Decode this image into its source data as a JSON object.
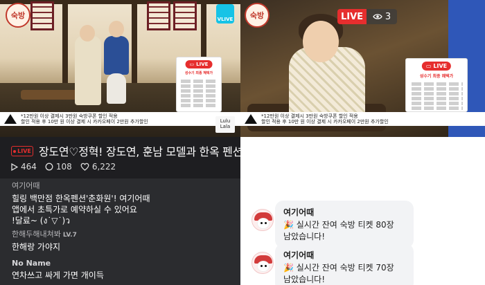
{
  "left": {
    "video": {
      "logo_text": "숙방",
      "vlive_label": "VLIVE",
      "promo": {
        "live_label": "LIVE",
        "title": "성수기 최종 혜택가"
      },
      "banner_lines": [
        "*12만원 이상 결제시 3만원 숙방쿠폰 할인 적용",
        "할인 적용 후 10만 원 이상 결제 시 카카오페이 2만원 추가할인"
      ],
      "watermark_lines": [
        "Lulu",
        "Lala"
      ]
    },
    "stream": {
      "live_label": "LIVE",
      "title": "장도연♡정혁! 장도연, 훈남 모델과 한옥 펜션",
      "stats": {
        "plays": "464",
        "comments": "108",
        "likes": "6,222"
      }
    },
    "chat": [
      {
        "author": "여기어때",
        "level": "",
        "bold": false,
        "lines": [
          "힐링 백만점 한옥펜션'춘화원'! 여기어때",
          "앱에서 초특가로 예약하실 수 있어요",
          "!달료~ (ง˙▽˙)ว"
        ]
      },
      {
        "author": "한해두해내쳐봐",
        "level": "LV.7",
        "bold": false,
        "lines": [
          "한해랑 가야지"
        ]
      },
      {
        "author": "No Name",
        "level": "",
        "bold": true,
        "lines": [
          "연차쓰고 싸게 가면 개이득"
        ]
      }
    ]
  },
  "right": {
    "video": {
      "logo_text": "숙방",
      "live_label": "LIVE",
      "viewer_count": "3",
      "promo": {
        "live_label": "LIVE",
        "title": "성수기 최종 혜택가"
      },
      "banner_lines": [
        "*12만원 이상 결제시 3만원 숙방쿠폰 할인 적용",
        "할인 적용 후 10만 원 이상 결제 시 카카오페이 2만원 추가할인"
      ]
    },
    "chat": [
      {
        "author": "여기어때",
        "lines": [
          "🎉 실시간 잔여 숙방 티켓 80장",
          "남았습니다!"
        ]
      },
      {
        "author": "여기어때",
        "lines": [
          "🎉 실시간 잔여 숙방 티켓 70장",
          "남았습니다!"
        ]
      }
    ]
  },
  "colors": {
    "live_red": "#e62e2e",
    "dark_bg": "#1e1e21",
    "chat_bg": "#2b2c2f",
    "bubble_bg": "#f2f3f5"
  }
}
